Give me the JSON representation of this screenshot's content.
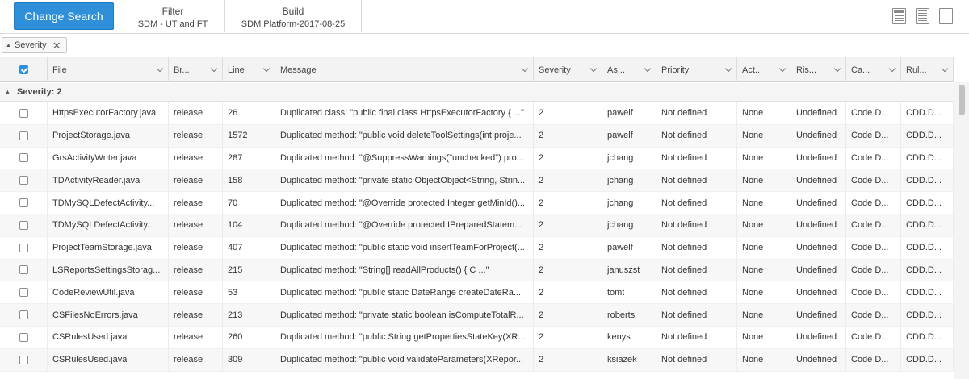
{
  "toolbar": {
    "change_search_label": "Change Search",
    "filter_title": "Filter",
    "filter_value": "SDM - UT and FT",
    "build_title": "Build",
    "build_value": "SDM Platform-2017-08-25",
    "accent_color": "#2f8fd8"
  },
  "group_chip": {
    "label": "Severity",
    "close": "✕"
  },
  "columns": [
    "File",
    "Br...",
    "Line",
    "Message",
    "Severity",
    "As...",
    "Priority",
    "Act...",
    "Ris...",
    "Ca...",
    "Rul..."
  ],
  "group": {
    "label": "Severity: 2"
  },
  "rows": [
    [
      "HttpsExecutorFactory.java",
      "release",
      "26",
      "Duplicated class: \"public final class HttpsExecutorFactory { ...\"",
      "2",
      "pawelf",
      "Not defined",
      "None",
      "Undefined",
      "Code D...",
      "CDD.D..."
    ],
    [
      "ProjectStorage.java",
      "release",
      "1572",
      "Duplicated method: \"public void deleteToolSettings(int proje...",
      "2",
      "pawelf",
      "Not defined",
      "None",
      "Undefined",
      "Code D...",
      "CDD.D..."
    ],
    [
      "GrsActivityWriter.java",
      "release",
      "287",
      "Duplicated method: \"@SuppressWarnings(\"unchecked\") pro...",
      "2",
      "jchang",
      "Not defined",
      "None",
      "Undefined",
      "Code D...",
      "CDD.D..."
    ],
    [
      "TDActivityReader.java",
      "release",
      "158",
      "Duplicated method: \"private static ObjectObject<String, Strin...",
      "2",
      "jchang",
      "Not defined",
      "None",
      "Undefined",
      "Code D...",
      "CDD.D..."
    ],
    [
      "TDMySQLDefectActivity...",
      "release",
      "70",
      "Duplicated method: \"@Override protected Integer getMinId()...",
      "2",
      "jchang",
      "Not defined",
      "None",
      "Undefined",
      "Code D...",
      "CDD.D..."
    ],
    [
      "TDMySQLDefectActivity...",
      "release",
      "104",
      "Duplicated method: \"@Override protected IPreparedStatem...",
      "2",
      "jchang",
      "Not defined",
      "None",
      "Undefined",
      "Code D...",
      "CDD.D..."
    ],
    [
      "ProjectTeamStorage.java",
      "release",
      "407",
      "Duplicated method: \"public static void insertTeamForProject(...",
      "2",
      "pawelf",
      "Not defined",
      "None",
      "Undefined",
      "Code D...",
      "CDD.D..."
    ],
    [
      "LSReportsSettingsStorag...",
      "release",
      "215",
      "Duplicated method: \"String[] readAllProducts() { C ...\"",
      "2",
      "januszst",
      "Not defined",
      "None",
      "Undefined",
      "Code D...",
      "CDD.D..."
    ],
    [
      "CodeReviewUtil.java",
      "release",
      "53",
      "Duplicated method: \"public static DateRange createDateRa...",
      "2",
      "tomt",
      "Not defined",
      "None",
      "Undefined",
      "Code D...",
      "CDD.D..."
    ],
    [
      "CSFilesNoErrors.java",
      "release",
      "213",
      "Duplicated method: \"private static boolean isComputeTotalR...",
      "2",
      "roberts",
      "Not defined",
      "None",
      "Undefined",
      "Code D...",
      "CDD.D..."
    ],
    [
      "CSRulesUsed.java",
      "release",
      "260",
      "Duplicated method: \"public String getPropertiesStateKey(XR...",
      "2",
      "kenys",
      "Not defined",
      "None",
      "Undefined",
      "Code D...",
      "CDD.D..."
    ],
    [
      "CSRulesUsed.java",
      "release",
      "309",
      "Duplicated method: \"public void validateParameters(XRepor...",
      "2",
      "ksiazek",
      "Not defined",
      "None",
      "Undefined",
      "Code D...",
      "CDD.D..."
    ]
  ]
}
